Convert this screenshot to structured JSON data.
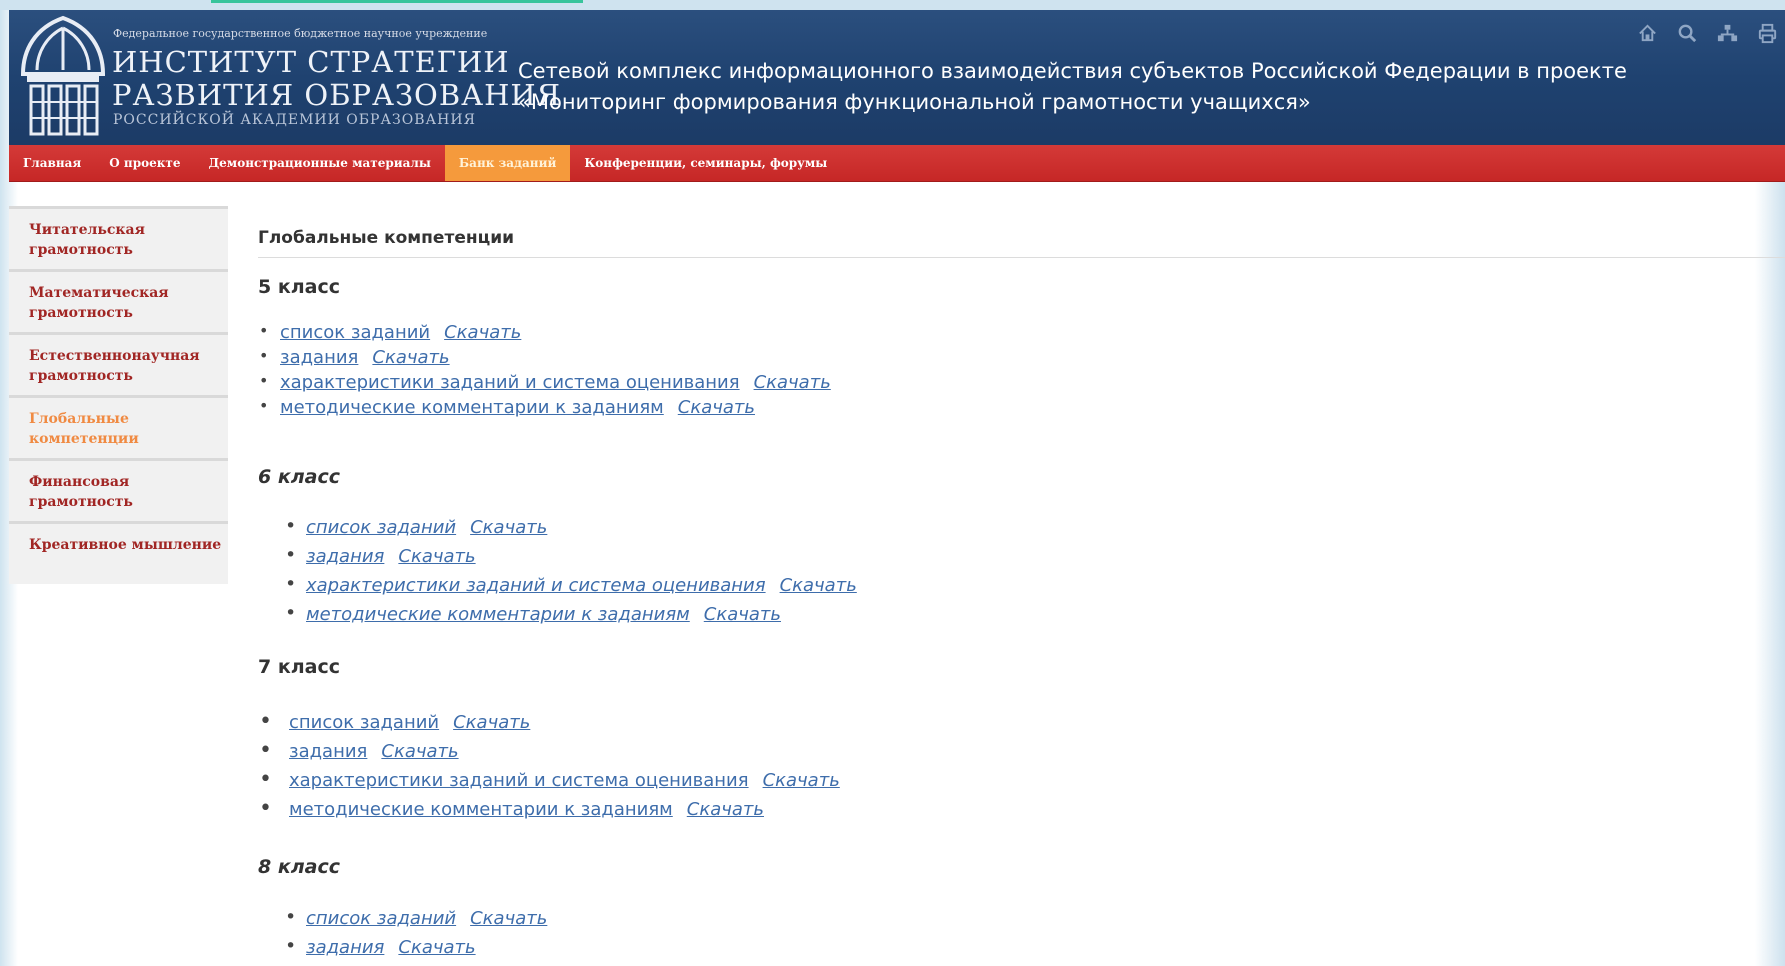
{
  "header": {
    "institute_small": "Федеральное государственное бюджетное научное учреждение",
    "institute_name_line1": "ИНСТИТУТ СТРАТЕГИИ",
    "institute_name_line2": "РАЗВИТИЯ ОБРАЗОВАНИЯ",
    "institute_sub": "РОССИЙСКОЙ АКАДЕМИИ ОБРАЗОВАНИЯ",
    "site_title": "Сетевой комплекс информационного взаимодействия субъектов Российской Федерации в проекте «Мониторинг формирования функциональной грамотности учащихся»",
    "icons": [
      "home-icon",
      "search-icon",
      "sitemap-icon",
      "print-icon"
    ]
  },
  "nav": {
    "items": [
      {
        "label": "Главная"
      },
      {
        "label": "О проекте"
      },
      {
        "label": "Демонстрационные материалы"
      },
      {
        "label": "Банк заданий",
        "active": true
      },
      {
        "label": "Конференции, семинары, форумы"
      }
    ]
  },
  "sidebar": {
    "items": [
      {
        "label": "Читательская грамотность"
      },
      {
        "label": "Математическая грамотность"
      },
      {
        "label": "Естественнонаучная грамотность"
      },
      {
        "label": "Глобальные компетенции",
        "active": true
      },
      {
        "label": "Финансовая грамотность"
      },
      {
        "label": "Креативное мышление"
      }
    ]
  },
  "main": {
    "title": "Глобальные компетенции",
    "grades": [
      {
        "title": "5 класс",
        "links": [
          {
            "text": "список заданий",
            "download": "Скачать"
          },
          {
            "text": "задания",
            "download": "Скачать"
          },
          {
            "text": "характеристики заданий и система оценивания",
            "download": "Скачать"
          },
          {
            "text": "методические комментарии к заданиям",
            "download": "Скачать"
          }
        ]
      },
      {
        "title": "6 класс",
        "links": [
          {
            "text": "список заданий",
            "download": "Скачать"
          },
          {
            "text": "задания",
            "download": "Скачать"
          },
          {
            "text": "характеристики заданий и система оценивания",
            "download": "Скачать"
          },
          {
            "text": "методические комментарии к заданиям",
            "download": "Скачать"
          }
        ]
      },
      {
        "title": "7 класс",
        "links": [
          {
            "text": "список заданий",
            "download": "Скачать"
          },
          {
            "text": "задания",
            "download": "Скачать"
          },
          {
            "text": "характеристики заданий и система оценивания",
            "download": "Скачать"
          },
          {
            "text": "методические комментарии к заданиям",
            "download": "Скачать"
          }
        ]
      },
      {
        "title": "8 класс",
        "links": [
          {
            "text": "список заданий",
            "download": "Скачать"
          },
          {
            "text": "задания",
            "download": "Скачать"
          }
        ]
      }
    ]
  },
  "colors": {
    "header_bg": "#1f4270",
    "nav_red": "#c62726",
    "nav_active": "#f59a3c",
    "sidebar_link": "#a12624",
    "sidebar_active": "#f08a42",
    "content_link": "#3e6dab"
  }
}
